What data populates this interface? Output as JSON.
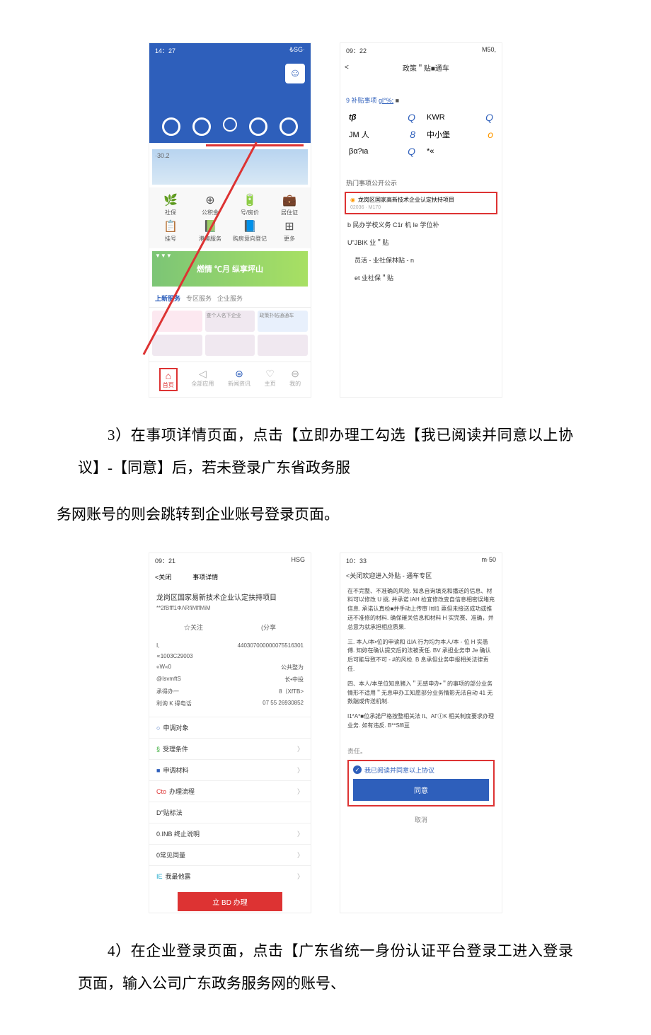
{
  "shot1": {
    "status_time": "14：27",
    "status_right": "₺SG·",
    "banner_tag": "·30.2",
    "grid": [
      {
        "icon": "🌿",
        "label": "社保"
      },
      {
        "icon": "⊕",
        "label": "公积金"
      },
      {
        "icon": "🔋",
        "label": "号/房价"
      },
      {
        "icon": "💼",
        "label": "居住证"
      },
      {
        "icon": "📋",
        "label": "挂号"
      },
      {
        "icon": "📗",
        "label": "港澳服务"
      },
      {
        "icon": "📘",
        "label": "购房意向登记"
      },
      {
        "icon": "⊞",
        "label": "更多"
      }
    ],
    "promo": "燃情 ℃月 纵享坪山",
    "tabs": [
      "上新服务",
      "专区服务",
      "企业服务"
    ],
    "card1": "查个人名下企业",
    "card2": "政策扑帖通通车",
    "bottom": [
      {
        "icon": "⌂",
        "label": "首页"
      },
      {
        "icon": "◁",
        "label": "全部应用"
      },
      {
        "icon": "⊜",
        "label": "新闻资讯"
      },
      {
        "icon": "♡",
        "label": "主页"
      },
      {
        "icon": "⊖",
        "label": "我的"
      }
    ]
  },
  "shot2": {
    "status_time": "09：22",
    "status_right": "M50,",
    "back": "<",
    "title": "政策＂贴■通车",
    "subsidy_line_pre": "9 补贴事项 ",
    "subsidy_line_link": "gl°%;",
    "subsidy_line_post": " ■",
    "cats": [
      {
        "l": "tβ",
        "lv": "Q",
        "r": "KWR",
        "rv": "Q"
      },
      {
        "l": "JM 人",
        "lv": "8",
        "r": "中小堡",
        "rv": "o",
        "rvclass": "o"
      },
      {
        "l": "βα?ιa",
        "lv": "Q",
        "r": "*«",
        "rv": ""
      }
    ],
    "section_title": "热门事项公开公示",
    "highlight": "龙岗区国家高新技术企业认定扶持项目",
    "highlight_sub": "02036 · M170",
    "items": [
      "b 民办学校义务 C1r 机 Ie 学位补",
      "U\"JBIK 业＂贴",
      "员活 - 业社保林贴 - n",
      "et 业社保＂贴"
    ]
  },
  "shot3": {
    "status_time": "09：21",
    "status_right": "HSG",
    "close": "<关闭",
    "header_title": "事项详情",
    "title": "龙岗区国家易新技术企业认定扶持项目",
    "subtitle": "**2fBfff1ΦΛRfiMffMiM",
    "fav": "☆关注",
    "share": "(分享",
    "info": [
      {
        "l": "I,",
        "r": "440307000000075516301"
      },
      {
        "l": "∝1003C29003",
        "r": ""
      },
      {
        "l": "«W«0",
        "r": "公共整为"
      },
      {
        "l": "@IsvmftS",
        "r": "长•中投"
      },
      {
        "l": "承得办一",
        "r": "8（XfTB>"
      },
      {
        "l": "利询 K 得电话",
        "r": "07 55 26930852"
      }
    ],
    "list": [
      {
        "icon": "○",
        "cls": "icon-o",
        "label": "申调对象"
      },
      {
        "icon": "§",
        "cls": "icon-g",
        "label": "受理条件"
      },
      {
        "icon": "■",
        "cls": "icon-sq",
        "label": "申调材料"
      },
      {
        "icon": "Cto",
        "cls": "icon-r",
        "label": "办理流程"
      },
      {
        "icon": "D\"",
        "cls": "",
        "label": "贴标法"
      },
      {
        "icon": "0.",
        "cls": "",
        "label": "INB 终止说明"
      },
      {
        "icon": "0",
        "cls": "",
        "label": "常见同量"
      },
      {
        "icon": "IE",
        "cls": "icon-y",
        "label": "我最他露"
      }
    ],
    "btn": "立 BD 办理"
  },
  "shot4": {
    "status_time": "10：33",
    "status_right": "m·50",
    "header": "<关闭欢迎进入外贴 - 通车专区",
    "para1": "在不完整、不准确的风险. 知息自询填充和播送的信息、材料可以修改 U 挑. 并承诺 iAH 检宜修改变自信息相密误堵充信息. 承诺认真检■并手动上传审 Ittll1 蒽但未接送成功或推送不准修的材料. 确保確关信息和材料 H 实完赛、准确，并总意为就承担相应质果.",
    "para2": "三. 本人/本•位的申读和 i1IA 行为均为本人/本 - 位 H 实愚傅. 知妳在确认提交后的法被责任. BV 承担业务申 Je 确认后可能导致不可 - #的风检. B 息承但业务申报相关法律责任.",
    "para3": "四、本人/本单位知息猪入＂无感申办•＂的事项的部分业务情形不适用＂无息申办工知愿部分业务情影无法自动 41 无数踹或传送机制.",
    "para4": "I1*A*■位承諾尸格按整相关法 It、ΑΓⒾΚ 相关制度要求办理业务. 如有违反. B**Sffi亘",
    "responsibility": "责任。",
    "checkbox_label": "我已阅读并同意以上协议",
    "agree_btn": "同意",
    "cancel_btn": "取消"
  },
  "text3": "3）在事项详情页面，点击【立即办理工勾选【我已阅读并同意以上协议】-【同意】后，若未登录广东省政务服",
  "text3b": "务网账号的则会跳转到企业账号登录页面。",
  "text4": "4）在企业登录页面，点击【广东省统一身份认证平台登录工进入登录页面，输入公司广东政务服务网的账号、"
}
